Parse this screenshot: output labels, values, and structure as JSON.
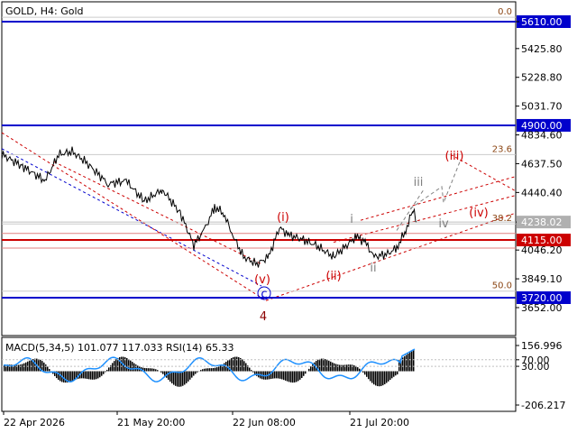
{
  "header": {
    "title": "GOLD, H4:  Gold"
  },
  "chart_data": {
    "type": "line",
    "title": "GOLD, H4:  Gold",
    "price_axis": {
      "ticks": [
        5610,
        5425.8,
        5228.8,
        5031.7,
        4834.6,
        4637.5,
        4440.4,
        4238.02,
        4046.2,
        3849.1,
        3652.0
      ],
      "tick_labels": [
        "5610.00",
        "5425.80",
        "5228.80",
        "5031.70",
        "4834.60",
        "4637.50",
        "4440.40",
        "4238.02",
        "4046.20",
        "3849.10",
        "3652.00"
      ],
      "ylim": [
        3590,
        5680
      ]
    },
    "time_axis": {
      "labels": [
        "22 Apr 2026",
        "21 May 20:00",
        "22 Jun 08:00",
        "21 Jul 20:00"
      ]
    },
    "horizontal_levels": [
      {
        "price": 5610.0,
        "label": "5610.00",
        "color": "#0000cc",
        "style": "solid-thick"
      },
      {
        "price": 4900.0,
        "label": "4900.00",
        "color": "#0000cc",
        "style": "solid-thick"
      },
      {
        "price": 4115.0,
        "label": "4115.00",
        "color": "#cc0000",
        "style": "solid-thick"
      },
      {
        "price": 3720.0,
        "label": "3720.00",
        "color": "#0000cc",
        "style": "solid-thick"
      },
      {
        "price": 4238.02,
        "label": "4238.02",
        "color": "#c0c0c0",
        "style": "current-price"
      }
    ],
    "fibonacci_levels": [
      {
        "label": "0.0",
        "price": 5640
      },
      {
        "label": "23.6",
        "price": 4700
      },
      {
        "label": "38.2",
        "price": 4225
      },
      {
        "label": "50.0",
        "price": 3765
      }
    ],
    "wave_labels": [
      {
        "text": "(i)",
        "color": "#cc0000"
      },
      {
        "text": "(ii)",
        "color": "#cc0000"
      },
      {
        "text": "(iii)",
        "color": "#cc0000"
      },
      {
        "text": "(iv)",
        "color": "#cc0000"
      },
      {
        "text": "(v)",
        "color": "#cc0000"
      },
      {
        "text": "i",
        "color": "#808080"
      },
      {
        "text": "ii",
        "color": "#808080"
      },
      {
        "text": "iii",
        "color": "#808080"
      },
      {
        "text": "iv",
        "color": "#808080"
      },
      {
        "text": "c",
        "color": "#0000cc"
      },
      {
        "text": "4",
        "color": "#8b0000"
      }
    ],
    "indicator": {
      "title": "MACD(5,34,5) 101.077 117.033 RSI(14) 65.33",
      "ticks": [
        156.996,
        70.0,
        30.0,
        -206.217
      ],
      "tick_labels": [
        "156.996",
        "70.00",
        "30.00",
        "-206.217"
      ],
      "ylim": [
        -206.217,
        156.996
      ]
    },
    "colors": {
      "price_line": "#000000",
      "support_blue": "#0000cc",
      "resistance_red": "#cc0000",
      "rsi_line": "#1e90ff",
      "macd_histogram": "#000000"
    }
  }
}
